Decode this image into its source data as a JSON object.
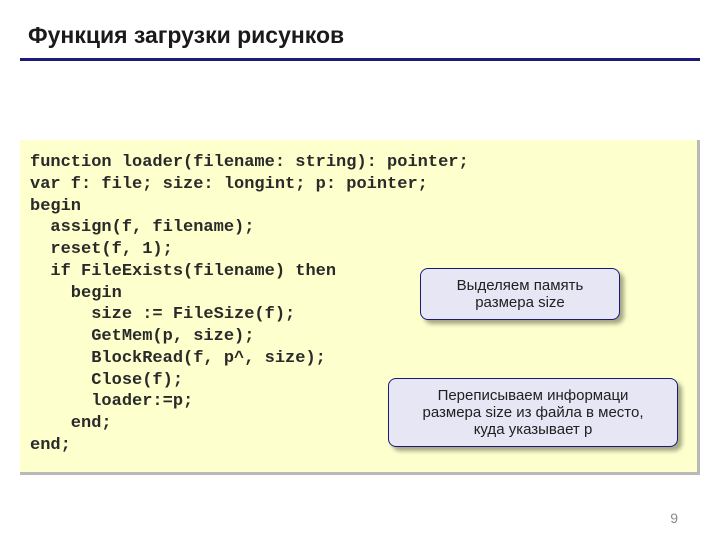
{
  "title": "Функция загрузки рисунков",
  "code": "function loader(filename: string): pointer;\nvar f: file; size: longint; p: pointer;\nbegin\n  assign(f, filename);\n  reset(f, 1);\n  if FileExists(filename) then\n    begin\n      size := FileSize(f);\n      GetMem(p, size);\n      BlockRead(f, p^, size);\n      Close(f);\n      loader:=p;\n    end;\nend;",
  "callout1_line1": "Выделяем память",
  "callout1_line2": "размера size",
  "callout2_line1": "Переписываем информаци",
  "callout2_line2": "размера size из файла в место,",
  "callout2_line3": "куда указывает p",
  "page_number": "9"
}
